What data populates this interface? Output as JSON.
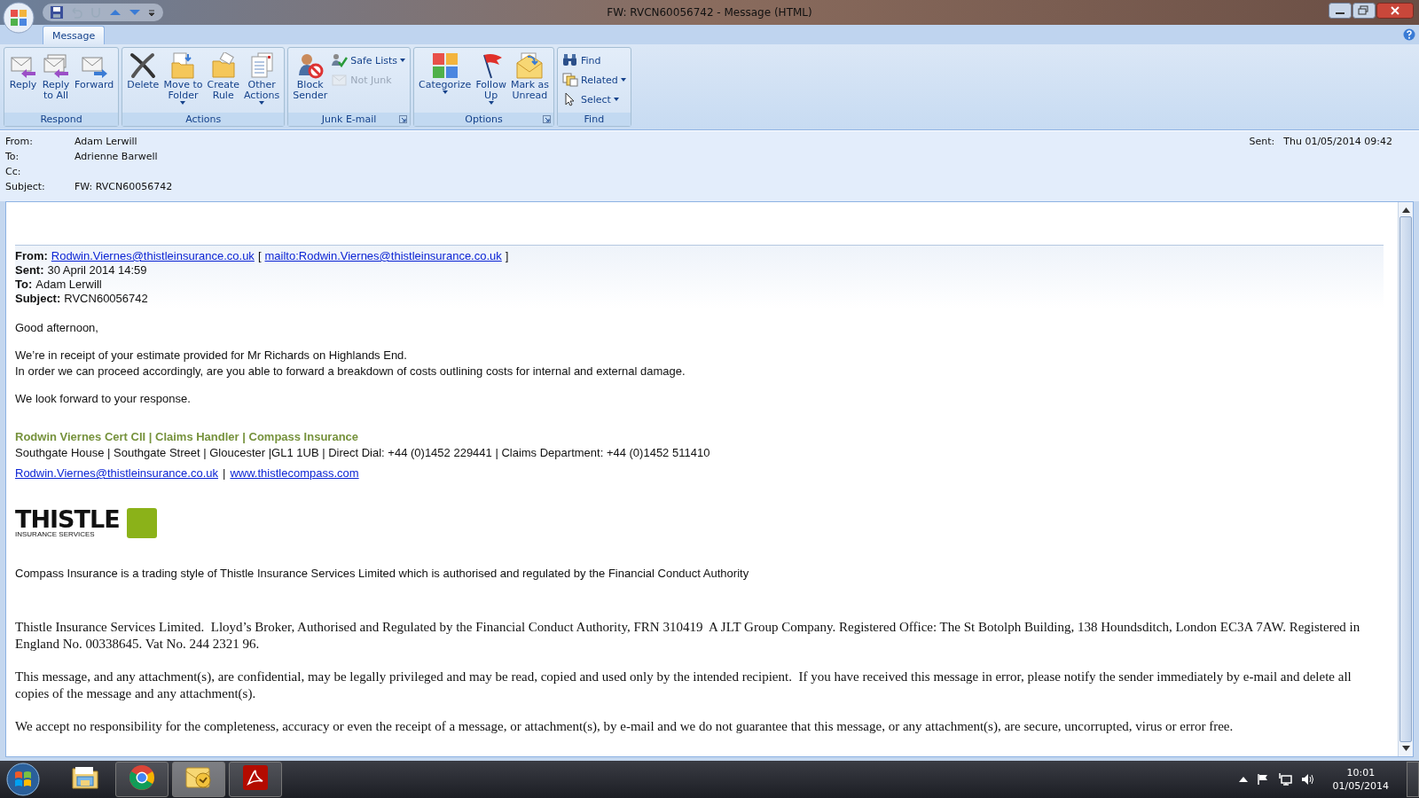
{
  "window": {
    "title": "FW: RVCN60056742 - Message (HTML)"
  },
  "ribbon": {
    "tabs": [
      {
        "label": "Message",
        "selected": true
      }
    ],
    "groups": [
      {
        "name": "Respond",
        "launcher": false,
        "buttons": [
          {
            "kind": "large",
            "lines": [
              "Reply"
            ],
            "dropdown": false,
            "disabled": false
          },
          {
            "kind": "large",
            "lines": [
              "Reply",
              "to All"
            ],
            "dropdown": false,
            "disabled": false
          },
          {
            "kind": "large",
            "lines": [
              "Forward"
            ],
            "dropdown": false,
            "disabled": false
          }
        ]
      },
      {
        "name": "Actions",
        "launcher": false,
        "buttons": [
          {
            "kind": "large",
            "lines": [
              "Delete"
            ],
            "dropdown": false,
            "disabled": false
          },
          {
            "kind": "large",
            "lines": [
              "Move to",
              "Folder"
            ],
            "dropdown": true,
            "disabled": false
          },
          {
            "kind": "large",
            "lines": [
              "Create",
              "Rule"
            ],
            "dropdown": false,
            "disabled": false
          },
          {
            "kind": "large",
            "lines": [
              "Other",
              "Actions"
            ],
            "dropdown": true,
            "disabled": false
          }
        ]
      },
      {
        "name": "Junk E-mail",
        "launcher": true,
        "buttons": [
          {
            "kind": "large",
            "lines": [
              "Block",
              "Sender"
            ],
            "dropdown": false,
            "disabled": false
          },
          {
            "kind": "small",
            "lines": [
              "Safe Lists"
            ],
            "dropdown": true,
            "disabled": false
          },
          {
            "kind": "small",
            "lines": [
              "Not Junk"
            ],
            "dropdown": false,
            "disabled": true
          }
        ]
      },
      {
        "name": "Options",
        "launcher": true,
        "buttons": [
          {
            "kind": "large",
            "lines": [
              "Categorize"
            ],
            "dropdown": true,
            "disabled": false
          },
          {
            "kind": "large",
            "lines": [
              "Follow",
              "Up"
            ],
            "dropdown": true,
            "disabled": false
          },
          {
            "kind": "large",
            "lines": [
              "Mark as",
              "Unread"
            ],
            "dropdown": false,
            "disabled": false
          }
        ]
      },
      {
        "name": "Find",
        "launcher": false,
        "buttons": [
          {
            "kind": "small",
            "lines": [
              "Find"
            ],
            "dropdown": false,
            "disabled": false
          },
          {
            "kind": "small",
            "lines": [
              "Related"
            ],
            "dropdown": true,
            "disabled": false
          },
          {
            "kind": "small",
            "lines": [
              "Select"
            ],
            "dropdown": true,
            "disabled": false
          }
        ]
      }
    ]
  },
  "header": {
    "fields": [
      {
        "label": "From:",
        "value": "Adam Lerwill"
      },
      {
        "label": "To:",
        "value": "Adrienne Barwell"
      },
      {
        "label": "Cc:"
      },
      {
        "label": "Subject:",
        "value": "FW: RVCN60056742"
      }
    ],
    "sent": {
      "label": "Sent:",
      "value": "Thu 01/05/2014 09:42"
    }
  },
  "message": {
    "forward_header": [
      {
        "segments": [
          {
            "kind": "label",
            "text": "From:"
          },
          {
            "kind": "link",
            "text": "Rodwin.Viernes@thistleinsurance.co.uk"
          },
          {
            "kind": "text",
            "text": "["
          },
          {
            "kind": "link",
            "text": "mailto:Rodwin.Viernes@thistleinsurance.co.uk"
          },
          {
            "kind": "text",
            "text": "]"
          }
        ]
      },
      {
        "segments": [
          {
            "kind": "label",
            "text": "Sent:"
          },
          {
            "kind": "text",
            "text": "30 April 2014 14:59"
          }
        ]
      },
      {
        "segments": [
          {
            "kind": "label",
            "text": "To:"
          },
          {
            "kind": "text",
            "text": "Adam Lerwill"
          }
        ]
      },
      {
        "segments": [
          {
            "kind": "label",
            "text": "Subject:"
          },
          {
            "kind": "text",
            "text": "RVCN60056742"
          }
        ]
      }
    ],
    "paragraphs": [
      [
        "Good afternoon,"
      ],
      [
        "We’re in receipt of your estimate provided for Mr Richards on Highlands End.",
        "In order we can proceed accordingly, are you able to forward a breakdown of costs outlining costs for internal and external damage."
      ],
      [
        "We look forward to your response."
      ]
    ],
    "signature": {
      "title": "Rodwin Viernes Cert CII | Claims Handler | Compass Insurance",
      "address": "Southgate House | Southgate Street | Gloucester |GL1 1UB | Direct Dial: +44 (0)1452 229441 | Claims Department: +44 (0)1452 511410",
      "links": [
        {
          "kind": "link",
          "text": "Rodwin.Viernes@thistleinsurance.co.uk"
        },
        {
          "kind": "text",
          "text": "|"
        },
        {
          "kind": "link",
          "text": "www.thistlecompass.com"
        }
      ]
    },
    "logo": {
      "name": "THISTLE",
      "tagline": "INSURANCE SERVICES"
    },
    "notice": "Compass Insurance is a trading style of Thistle Insurance Services Limited which is authorised and regulated by the Financial Conduct Authority",
    "legal": [
      "Thistle Insurance Services Limited.  Lloyd’s Broker, Authorised and Regulated by the Financial Conduct Authority, FRN 310419  A JLT Group Company. Registered Office: The St Botolph Building, 138 Houndsditch, London EC3A 7AW. Registered in England No. 00338645. Vat No. 244 2321 96.",
      "This message, and any attachment(s), are confidential, may be legally privileged and may be read, copied and used only by the intended recipient.  If you have received this message in error, please notify the sender immediately by e-mail and delete all copies of the message and any attachment(s).",
      "We accept no responsibility for the completeness, accuracy or even the receipt of a message, or attachment(s), by e-mail and we do not guarantee that this message, or any attachment(s), are secure, uncorrupted, virus or error free."
    ]
  },
  "taskbar": {
    "items": [
      {
        "running": false,
        "selected": false
      },
      {
        "running": true,
        "selected": false
      },
      {
        "running": true,
        "selected": true
      },
      {
        "running": true,
        "selected": false
      }
    ],
    "clock": {
      "time": "10:01",
      "date": "01/05/2014"
    }
  }
}
